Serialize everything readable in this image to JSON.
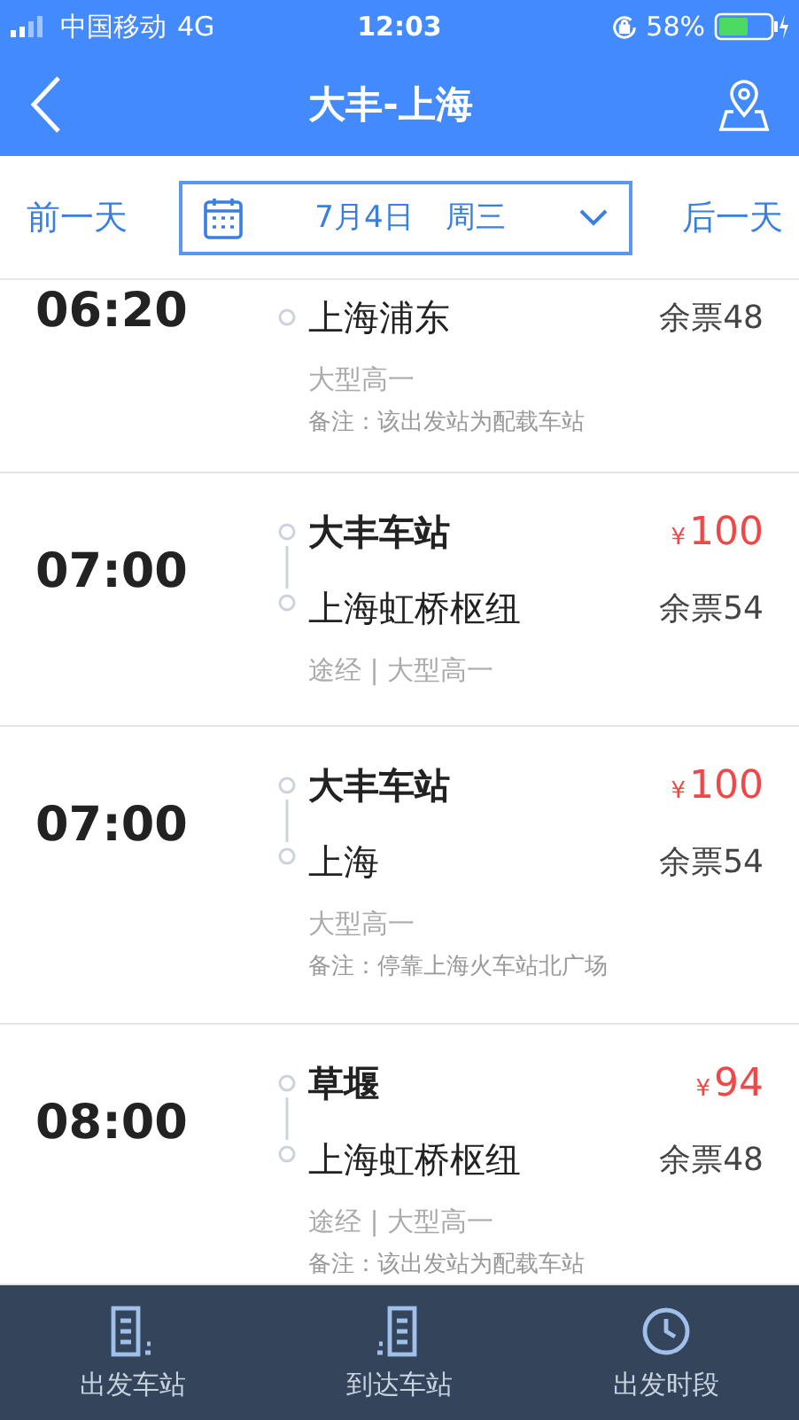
{
  "status_bar": {
    "carrier": "中国移动",
    "network": "4G",
    "time": "12:03",
    "battery": "58%"
  },
  "nav": {
    "title": "大丰-上海"
  },
  "date_bar": {
    "prev": "前一天",
    "date": "7月4日",
    "weekday": "周三",
    "next": "后一天"
  },
  "trips": [
    {
      "time": "06:20",
      "to": "上海浦东",
      "seats": "余票48",
      "info": "大型高一",
      "note": "备注：该出发站为配载车站"
    },
    {
      "time": "07:00",
      "from": "大丰车站",
      "price_symbol": "¥",
      "price": "100",
      "to": "上海虹桥枢纽",
      "seats": "余票54",
      "info": "途经 | 大型高一"
    },
    {
      "time": "07:00",
      "from": "大丰车站",
      "price_symbol": "¥",
      "price": "100",
      "to": "上海",
      "seats": "余票54",
      "info": "大型高一",
      "note": "备注：停靠上海火车站北广场"
    },
    {
      "time": "08:00",
      "from": "草堰",
      "price_symbol": "¥",
      "price": "94",
      "to": "上海虹桥枢纽",
      "seats": "余票48",
      "info": "途经 | 大型高一",
      "note": "备注：该出发站为配载车站"
    }
  ],
  "tab_bar": [
    {
      "kind": "depart",
      "label": "出发车站"
    },
    {
      "kind": "arrive",
      "label": "到达车站"
    },
    {
      "kind": "time",
      "label": "出发时段"
    }
  ]
}
